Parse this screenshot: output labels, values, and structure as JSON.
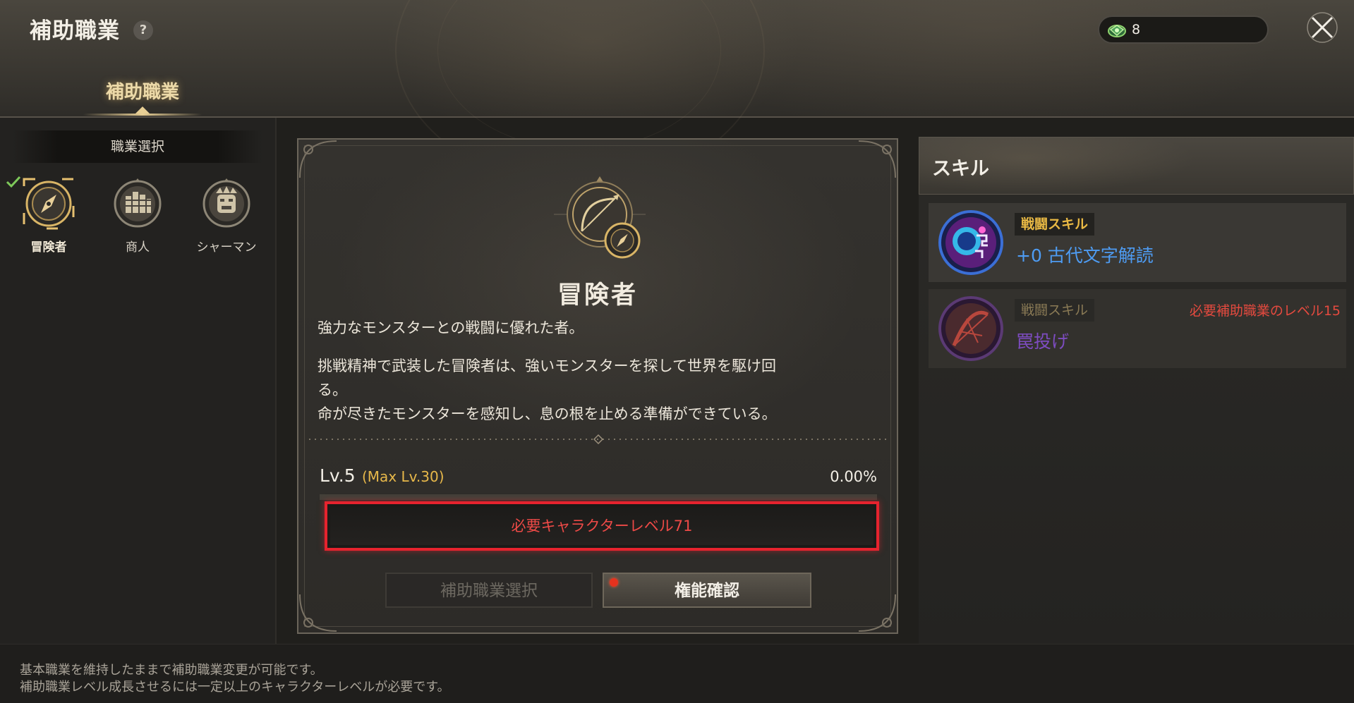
{
  "header": {
    "title": "補助職業",
    "help_label": "?",
    "currency": {
      "icon": "gem-currency-icon",
      "value": "8"
    },
    "tab_label": "補助職業"
  },
  "left_panel": {
    "header": "職業選択",
    "jobs": [
      {
        "label": "冒険者",
        "icon": "compass-icon",
        "selected": true
      },
      {
        "label": "商人",
        "icon": "coins-icon",
        "selected": false
      },
      {
        "label": "シャーマン",
        "icon": "tribal-mask-icon",
        "selected": false
      }
    ]
  },
  "center_panel": {
    "job_name": "冒険者",
    "desc_line1": "強力なモンスターとの戦闘に優れた者。",
    "desc_line2": "挑戦精神で武装した冒険者は、強いモンスターを探して世界を駆け回",
    "desc_line3": "る。",
    "desc_line4": "命が尽きたモンスターを感知し、息の根を止める準備ができている。",
    "level": "Lv.5",
    "max_level": "(Max Lv.30)",
    "percent": "0.00%",
    "progress_fraction": 0.0,
    "requirement": "必要キャラクターレベル71",
    "select_button": "補助職業選択",
    "confirm_button": "権能確認"
  },
  "right_panel": {
    "header": "スキル",
    "skills": [
      {
        "tag": "戦闘スキル",
        "name": "+0 古代文字解読",
        "requirement": ""
      },
      {
        "tag": "戦闘スキル",
        "name": "罠投げ",
        "requirement": "必要補助職業のレベル15"
      }
    ]
  },
  "footer": {
    "line1": "基本職業を維持したままで補助職業変更が可能です。",
    "line2": "補助職業レベル成長させるには一定以上のキャラクターレベルが必要です。"
  },
  "colors": {
    "accent_gold": "#e7b84a",
    "requirement_red": "#e6232e",
    "skill_blue": "#4e9cf3",
    "skill_purple": "#7d4cc0"
  }
}
